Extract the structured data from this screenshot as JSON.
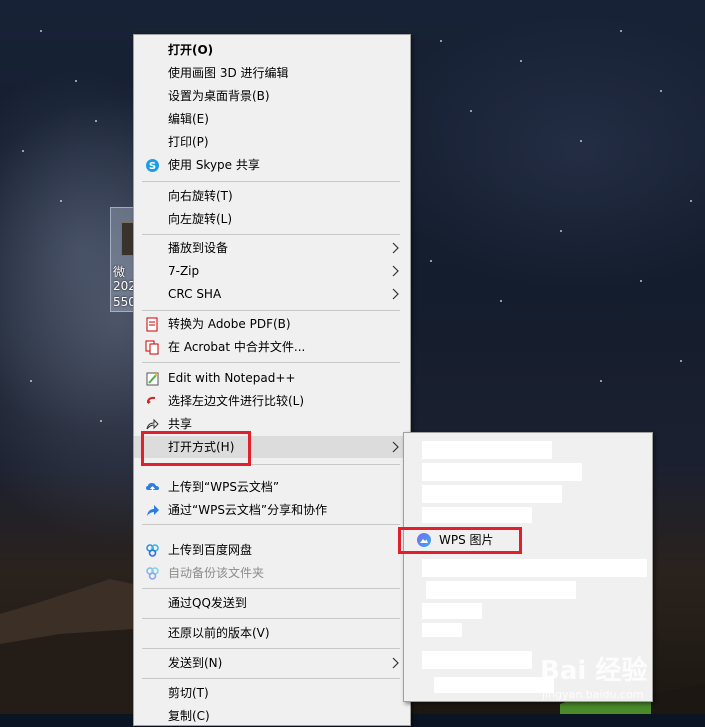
{
  "desktop_file": {
    "lines": [
      "微",
      "202",
      "550"
    ]
  },
  "menu": {
    "items": [
      {
        "name": "open",
        "label": "打开(O)",
        "bold": true,
        "icon": null
      },
      {
        "name": "edit-with-paint3d",
        "label": "使用画图 3D 进行编辑"
      },
      {
        "name": "set-as-background",
        "label": "设置为桌面背景(B)"
      },
      {
        "name": "edit",
        "label": "编辑(E)"
      },
      {
        "name": "print",
        "label": "打印(P)"
      },
      {
        "name": "share-with-skype",
        "label": "使用 Skype 共享",
        "icon": "skype-icon"
      },
      {
        "name": "rotate-right",
        "label": "向右旋转(T)"
      },
      {
        "name": "rotate-left",
        "label": "向左旋转(L)"
      },
      {
        "name": "cast-to-device",
        "label": "播放到设备",
        "submenu": true
      },
      {
        "name": "7zip",
        "label": "7-Zip",
        "submenu": true
      },
      {
        "name": "crc-sha",
        "label": "CRC SHA",
        "submenu": true
      },
      {
        "name": "convert-to-pdf",
        "label": "转换为 Adobe PDF(B)",
        "icon": "adobe-pdf-icon"
      },
      {
        "name": "combine-in-acrobat",
        "label": "在 Acrobat 中合并文件...",
        "icon": "acrobat-combine-icon"
      },
      {
        "name": "edit-with-notepadpp",
        "label": "Edit with Notepad++",
        "icon": "notepadpp-icon"
      },
      {
        "name": "select-left-compare",
        "label": "选择左边文件进行比较(L)",
        "icon": "compare-icon"
      },
      {
        "name": "share",
        "label": "共享",
        "icon": "share-icon"
      },
      {
        "name": "open-with",
        "label": "打开方式(H)",
        "submenu": true,
        "highlighted": true
      },
      {
        "name": "upload-wps-cloud",
        "label": "上传到“WPS云文档”",
        "icon": "cloud-upload-icon"
      },
      {
        "name": "share-via-wps-cloud",
        "label": "通过“WPS云文档”分享和协作",
        "icon": "share-arrow-icon"
      },
      {
        "name": "upload-baidu-netdisk",
        "label": "上传到百度网盘",
        "icon": "baidu-netdisk-icon"
      },
      {
        "name": "auto-backup-folder",
        "label": "自动备份该文件夹",
        "icon": "baidu-netdisk-icon",
        "disabled": true
      },
      {
        "name": "send-via-qq",
        "label": "通过QQ发送到"
      },
      {
        "name": "restore-previous-versions",
        "label": "还原以前的版本(V)"
      },
      {
        "name": "send-to",
        "label": "发送到(N)",
        "submenu": true
      },
      {
        "name": "cut",
        "label": "剪切(T)"
      },
      {
        "name": "copy",
        "label": "复制(C)"
      }
    ]
  },
  "submenu": {
    "wps_item": {
      "label": "WPS 图片",
      "icon": "wps-picture-icon"
    }
  },
  "watermark": {
    "text": "Bai 经验",
    "url": "jingyan.baidu.com"
  },
  "colors": {
    "annotation_red": "#e0202a",
    "menu_bg": "#f0f0f0"
  }
}
